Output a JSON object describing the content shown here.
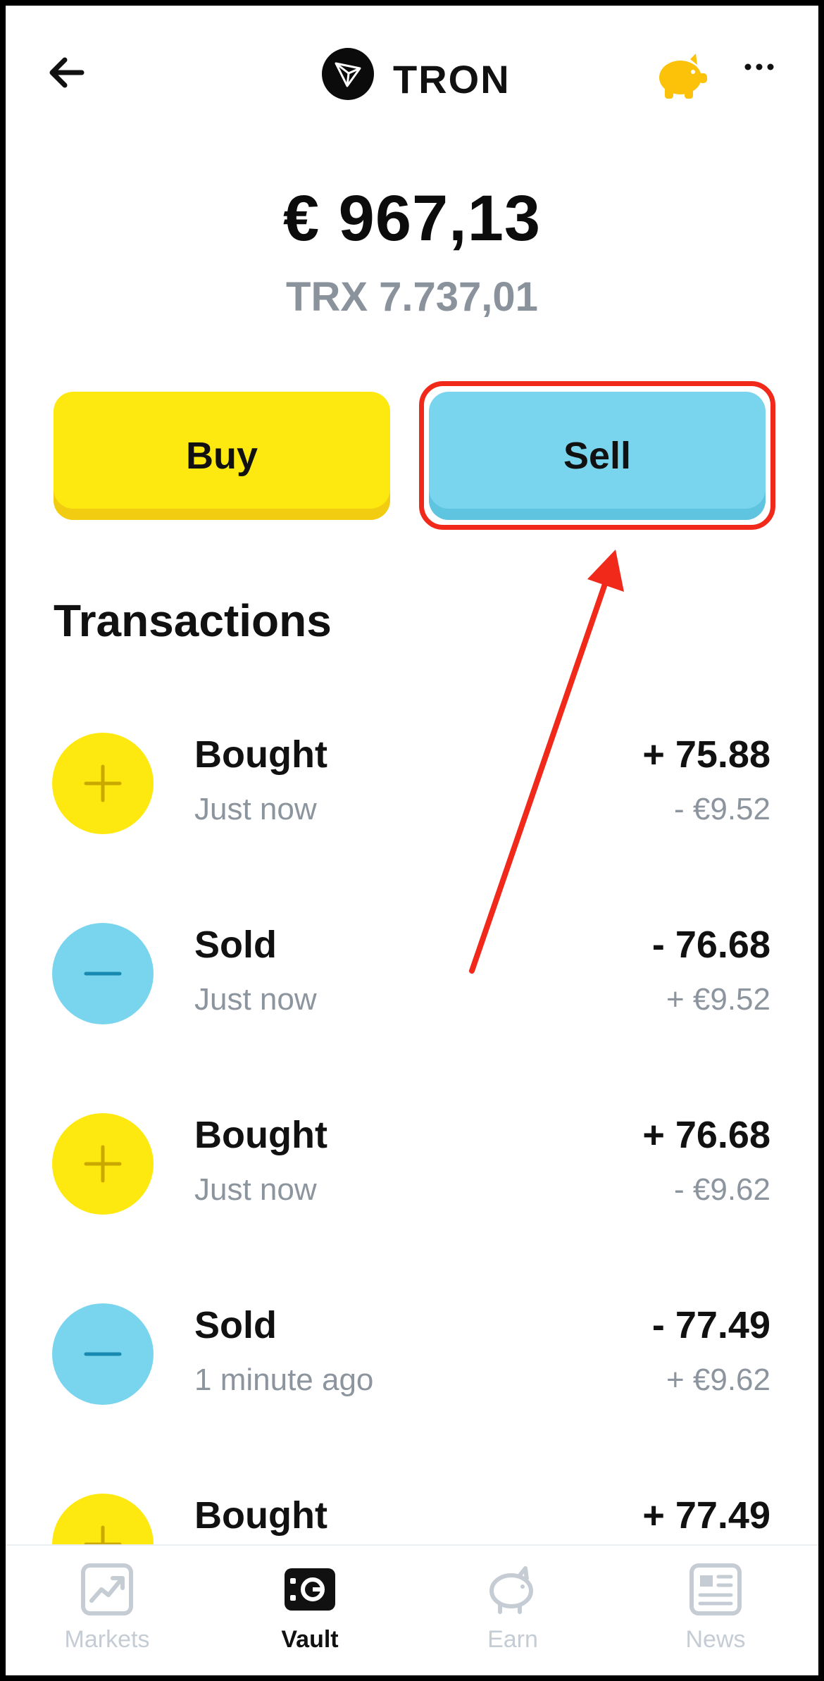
{
  "header": {
    "coin_name": "TRON",
    "icons": [
      "arrow-left-icon",
      "tron-logo-icon",
      "piggy-bank-icon",
      "more-dots-icon"
    ]
  },
  "balance": {
    "fiat": "€ 967,13",
    "crypto": "TRX 7.737,01"
  },
  "actions": {
    "buy_label": "Buy",
    "sell_label": "Sell"
  },
  "transactions": {
    "title": "Transactions",
    "items": [
      {
        "type": "buy",
        "title": "Bought",
        "time": "Just now",
        "amount": "+ 75.88",
        "fiat": "- €9.52"
      },
      {
        "type": "sell",
        "title": "Sold",
        "time": "Just now",
        "amount": "- 76.68",
        "fiat": "+ €9.52"
      },
      {
        "type": "buy",
        "title": "Bought",
        "time": "Just now",
        "amount": "+ 76.68",
        "fiat": "- €9.62"
      },
      {
        "type": "sell",
        "title": "Sold",
        "time": "1 minute ago",
        "amount": "- 77.49",
        "fiat": "+ €9.62"
      },
      {
        "type": "buy",
        "title": "Bought",
        "time": "",
        "amount": "+ 77.49",
        "fiat": ""
      }
    ]
  },
  "nav": {
    "items": [
      {
        "label": "Markets",
        "icon": "chart-icon",
        "active": false
      },
      {
        "label": "Vault",
        "icon": "vault-icon",
        "active": true
      },
      {
        "label": "Earn",
        "icon": "piggy-bank-icon",
        "active": false
      },
      {
        "label": "News",
        "icon": "newspaper-icon",
        "active": false
      }
    ]
  },
  "colors": {
    "buy": "#fde910",
    "sell": "#79d5ee",
    "highlight": "#f0291b",
    "muted_text": "#8c949e"
  }
}
